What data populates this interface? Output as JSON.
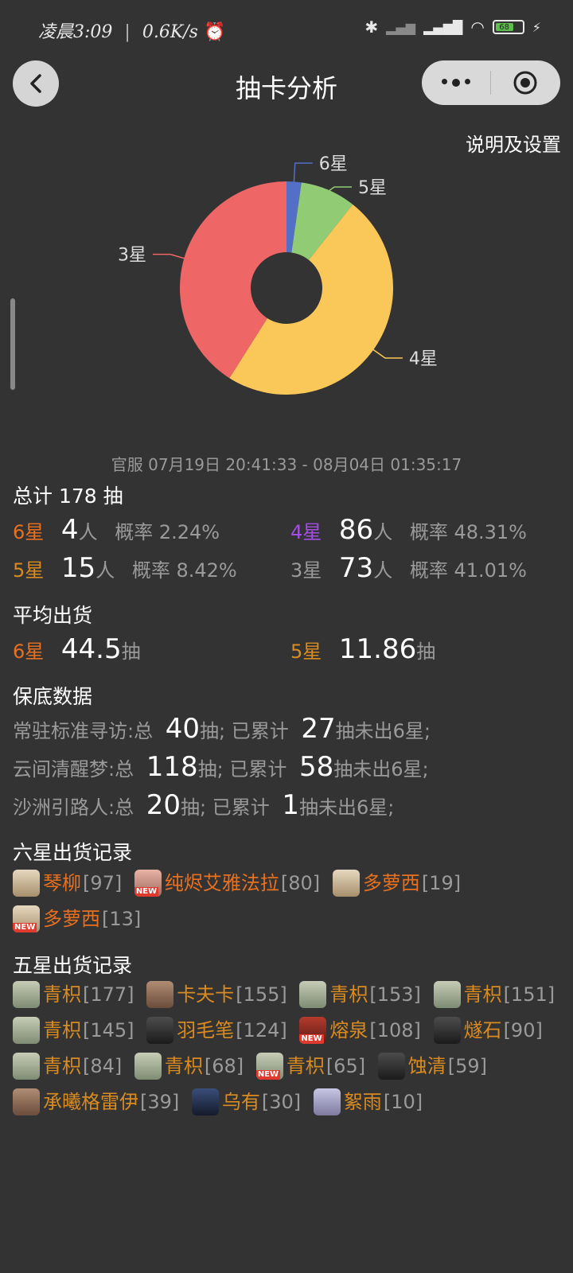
{
  "status_bar": {
    "time": "凌晨3:09",
    "speed": "0.6K/s",
    "battery": "68"
  },
  "header": {
    "title": "抽卡分析",
    "back_label": "<",
    "settings_link": "说明及设置"
  },
  "chart_data": {
    "type": "pie",
    "donut": true,
    "categories": [
      "6星",
      "5星",
      "4星",
      "3星"
    ],
    "values": [
      4,
      15,
      86,
      73
    ],
    "colors": [
      "#5470c6",
      "#91cc75",
      "#fac858",
      "#ee6666"
    ]
  },
  "summary": {
    "date_range": "官服  07月19日 20:41:33  -  08月04日 01:35:17",
    "total_title": "总计 178 抽",
    "rows": [
      {
        "star": "6星",
        "count": "4",
        "unit": "人",
        "prob": "概率 2.24%"
      },
      {
        "star": "4星",
        "count": "86",
        "unit": "人",
        "prob": "概率 48.31%"
      },
      {
        "star": "5星",
        "count": "15",
        "unit": "人",
        "prob": "概率 8.42%"
      },
      {
        "star": "3星",
        "count": "73",
        "unit": "人",
        "prob": "概率 41.01%"
      }
    ]
  },
  "average": {
    "title": "平均出货",
    "items": [
      {
        "star": "6星",
        "value": "44.5",
        "unit": "抽"
      },
      {
        "star": "5星",
        "value": "11.86",
        "unit": "抽"
      }
    ]
  },
  "pity": {
    "title": "保底数据",
    "rows": [
      {
        "pool": "常驻标准寻访:总",
        "total": "40",
        "mid": "抽;  已累计",
        "acc": "27",
        "tail": "抽未出6星;"
      },
      {
        "pool": "云间清醒梦:总",
        "total": "118",
        "mid": "抽;  已累计",
        "acc": "58",
        "tail": "抽未出6星;"
      },
      {
        "pool": "沙洲引路人:总",
        "total": "20",
        "mid": "抽;  已累计",
        "acc": "1",
        "tail": "抽未出6星;"
      }
    ]
  },
  "six_star_records": {
    "title": "六星出货记录",
    "badge_text": "NEW",
    "items": [
      {
        "name": "琴柳",
        "count": "[97]"
      },
      {
        "name": "纯烬艾雅法拉",
        "count": "[80]"
      },
      {
        "name": "多萝西",
        "count": "[19]"
      },
      {
        "name": "多萝西",
        "count": "[13]"
      }
    ]
  },
  "five_star_records": {
    "title": "五星出货记录",
    "items": [
      {
        "name": "青枳",
        "count": "[177]"
      },
      {
        "name": "卡夫卡",
        "count": "[155]"
      },
      {
        "name": "青枳",
        "count": "[153]"
      },
      {
        "name": "青枳",
        "count": "[151]"
      },
      {
        "name": "青枳",
        "count": "[145]"
      },
      {
        "name": "羽毛笔",
        "count": "[124]"
      },
      {
        "name": "熔泉",
        "count": "[108]"
      },
      {
        "name": "燧石",
        "count": "[90]"
      },
      {
        "name": "青枳",
        "count": "[84]"
      },
      {
        "name": "青枳",
        "count": "[68]"
      },
      {
        "name": "青枳",
        "count": "[65]"
      },
      {
        "name": "蚀清",
        "count": "[59]"
      },
      {
        "name": "承曦格雷伊",
        "count": "[39]"
      },
      {
        "name": "乌有",
        "count": "[30]"
      },
      {
        "name": "絮雨",
        "count": "[10]"
      }
    ]
  }
}
